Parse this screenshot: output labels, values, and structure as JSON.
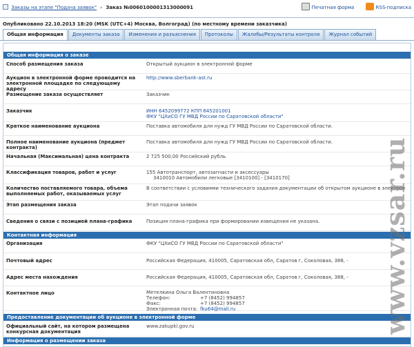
{
  "breadcrumb": {
    "stage_link": "Заказы на этапе \"Подача заявок\"",
    "current": "Заказ №0060100001313000091"
  },
  "top_links": {
    "print": "Печатная форма",
    "rss": "RSS-подписка"
  },
  "published": "Опубликовано 22.10.2013 18:20 (MSK (UTC+4) Москва, Волгоград) (по местному времени заказчика)",
  "tabs": [
    "Общая информация",
    "Документы заказа",
    "Изменения и разъяснения",
    "Протоколы",
    "Жалобы/Результаты контроля",
    "Журнал событий"
  ],
  "sections": {
    "general": "Общая информация о заказе",
    "contacts": "Контактная информация",
    "docs": "Предоставление документации об аукционе в электронной форме",
    "placement": "Информация о размещении заказа"
  },
  "general_rows": [
    {
      "label": "Способ размещения заказа",
      "value": "Открытый аукцион в электронной форме"
    },
    {
      "label": "Аукцион в электронной форме проводится на электронной площадке по следующему адресу",
      "value": "http://www.sberbank-ast.ru"
    },
    {
      "label": "Размещение заказа осуществляет",
      "value": "Заказчик"
    },
    {
      "label": "Заказчик",
      "value": "ИНН 6452099772 КПП 645201001",
      "value2": "ФКУ \"ЦХиСО ГУ МВД России по Саратовской области\""
    },
    {
      "label": "Краткое наименование аукциона",
      "value": "Поставка автомобиля для нужд ГУ МВД России по Саратовской области."
    },
    {
      "label": "Полное наименование аукциона (предмет контракта)",
      "value": "Поставка автомобиля для нужд ГУ МВД России по Саратовской области."
    },
    {
      "label": "Начальная (Максимальная) цена контракта",
      "value": "2 725 500,00 Российский рубль"
    },
    {
      "label": "Классификация товаров, работ и услуг",
      "value": "155 Автотранспорт, автозапчасти и аксессуары",
      "value2": "3410010 Автомобили легковые [3410100] - [3410170]"
    },
    {
      "label": "Количество поставляемого товара, объема выполняемых работ, оказываемых услуг",
      "value": "В соответствии с условиями технического задания документации об открытом аукционе в электронной форме"
    },
    {
      "label": "Этап размещения заказа",
      "value": "Этап подачи заявок"
    },
    {
      "label": "Сведения о связи с позицией плана-графика",
      "value": "Позиция плана-графика при формировании извещения не указана."
    }
  ],
  "contact_rows": [
    {
      "label": "Организация",
      "value": "ФКУ \"ЦХиСО ГУ МВД России по Саратовской области\""
    },
    {
      "label": "Почтовый адрес",
      "value": "Российская Федерация, 410005, Саратовская обл, Саратов г, Соколовая, 388, -"
    },
    {
      "label": "Адрес места нахождения",
      "value": "Российская Федерация, 410005, Саратовская обл, Саратов г, Соколовая, 388, -"
    }
  ],
  "contact_person": {
    "label": "Контактное лицо",
    "name": "Метелкина Ольга Валентиновна",
    "phone_label": "Телефон:",
    "phone": "+7 (8452) 994857",
    "fax_label": "Факс:",
    "fax": "+7 (8452) 994857",
    "email_label": "Электронная почта:",
    "email": "fku64@mail.ru"
  },
  "docs_rows": [
    {
      "label": "Официальный сайт, на котором размещена конкурсная документация",
      "value": "www.zakupki.gov.ru"
    }
  ],
  "watermark": "www.vzsar.ru",
  "colors": {
    "section_bg": "#2c6fb0",
    "link": "#1a4f9c"
  }
}
